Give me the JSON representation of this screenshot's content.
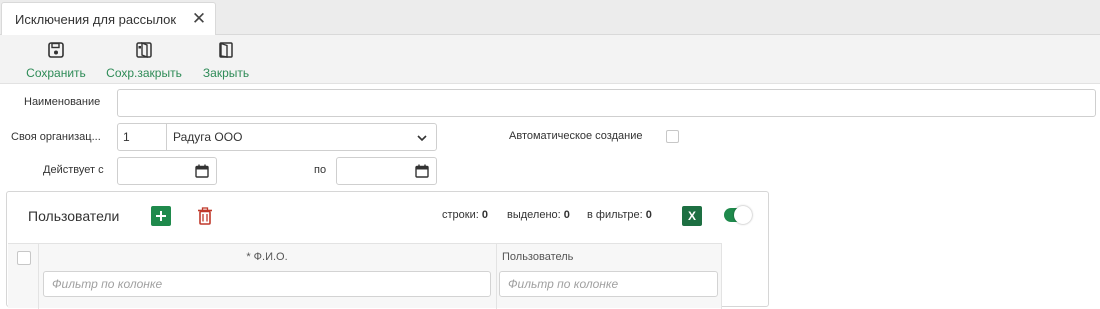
{
  "tab": {
    "title": "Исключения для рассылок",
    "close_icon": "close-icon"
  },
  "toolbar": {
    "save_label": "Сохранить",
    "save_close_label": "Сохр.закрыть",
    "close_label": "Закрыть"
  },
  "form": {
    "name_label": "Наименование",
    "name_value": "",
    "org_label": "Своя организац...",
    "org_code": "1",
    "org_name": "Радуга ООО",
    "auto_label": "Автоматическое создание",
    "auto_checked": false,
    "valid_from_label": "Действует с",
    "valid_from_value": "",
    "valid_to_label": "по",
    "valid_to_value": ""
  },
  "users": {
    "title": "Пользователи",
    "rows_label": "строки:",
    "rows_value": "0",
    "selected_label": "выделено:",
    "selected_value": "0",
    "filtered_label": "в фильтре:",
    "filtered_value": "0",
    "excel_label": "X",
    "toggle_on": true,
    "columns": [
      {
        "header": "* Ф.И.О.",
        "filter_placeholder": "Фильтр по колонке"
      },
      {
        "header": "Пользователь",
        "filter_placeholder": "Фильтр по колонке"
      }
    ]
  },
  "colors": {
    "accent_green": "#2e8b57",
    "add_button": "#1f8a4c",
    "delete_button": "#c0392b",
    "excel_button": "#1d6f42"
  }
}
